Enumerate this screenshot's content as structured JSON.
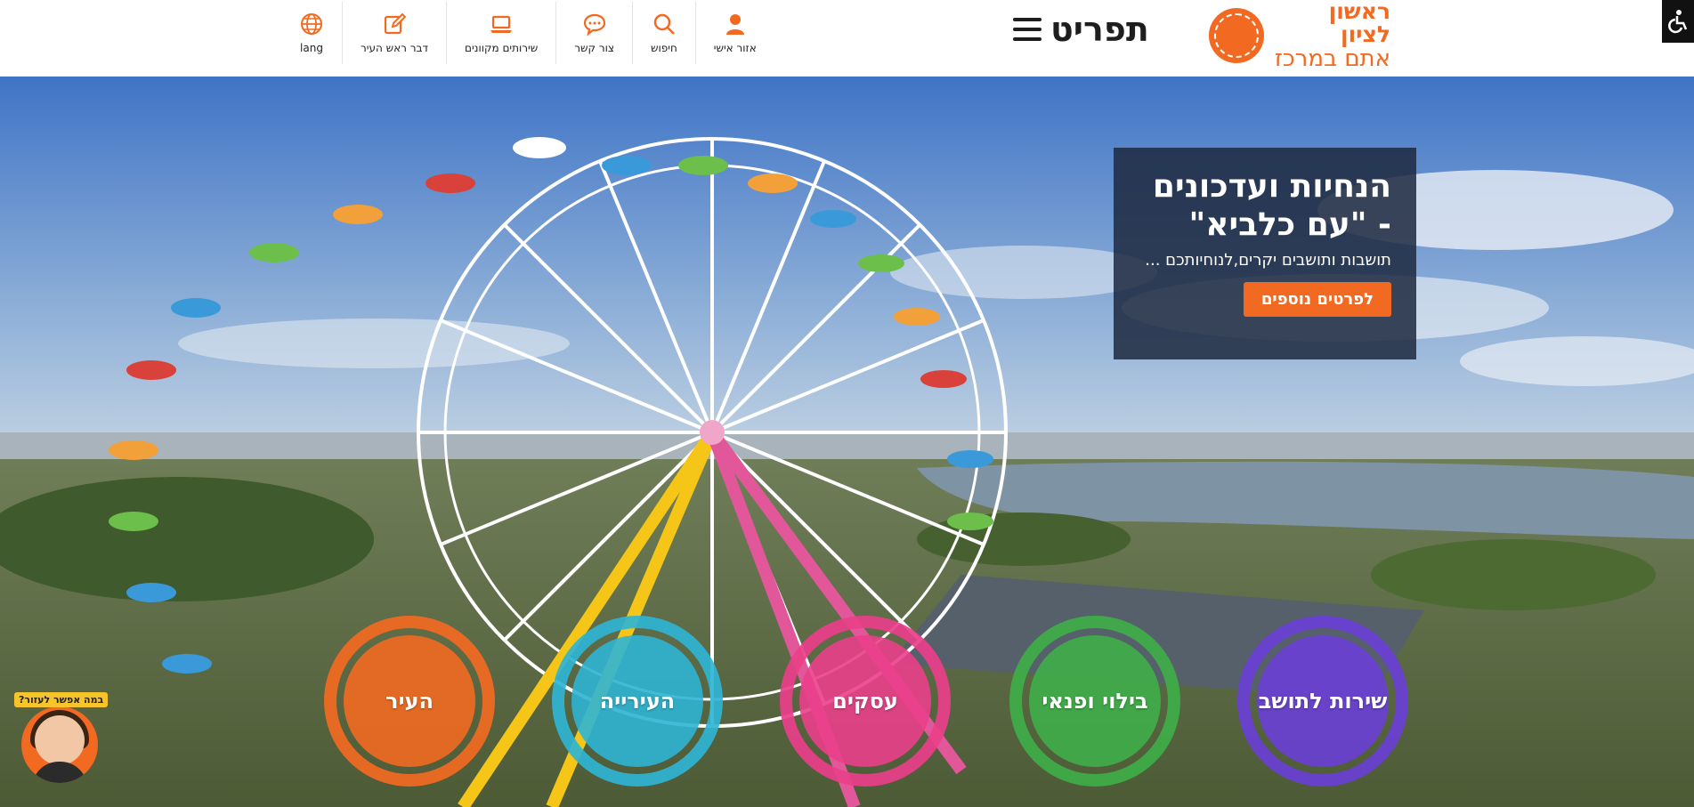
{
  "header": {
    "logo_line1": "ראשון לציון",
    "logo_line2": "אתם במרכז",
    "menu_label": "תפריט",
    "nav": [
      {
        "label": "אזור אישי",
        "icon": "user-icon"
      },
      {
        "label": "חיפוש",
        "icon": "search-icon"
      },
      {
        "label": "צור קשר",
        "icon": "chat-icon"
      },
      {
        "label": "שירותים מקוונים",
        "icon": "laptop-icon"
      },
      {
        "label": "דבר ראש העיר",
        "icon": "edit-icon"
      },
      {
        "label": "lang",
        "icon": "globe-icon"
      }
    ],
    "accessibility_icon": "wheelchair-icon"
  },
  "promo": {
    "title": "הנחיות ועדכונים - \"עם כלביא\"",
    "text": "תושבות ותושבים יקרים,לנוחיותכם ...",
    "button": "לפרטים נוספים"
  },
  "categories": [
    {
      "label": "שירות לתושב",
      "color": "#6a3fd6"
    },
    {
      "label": "בילוי ופנאי",
      "color": "#3fae49"
    },
    {
      "label": "עסקים",
      "color": "#ea3f8a"
    },
    {
      "label": "העירייה",
      "color": "#2fb4d4"
    },
    {
      "label": "העיר",
      "color": "#f26a21"
    }
  ],
  "helper": {
    "tag": "במה אפשר לעזור?"
  },
  "colors": {
    "brand": "#f26a21",
    "promo_bg": "#1e2a40"
  }
}
